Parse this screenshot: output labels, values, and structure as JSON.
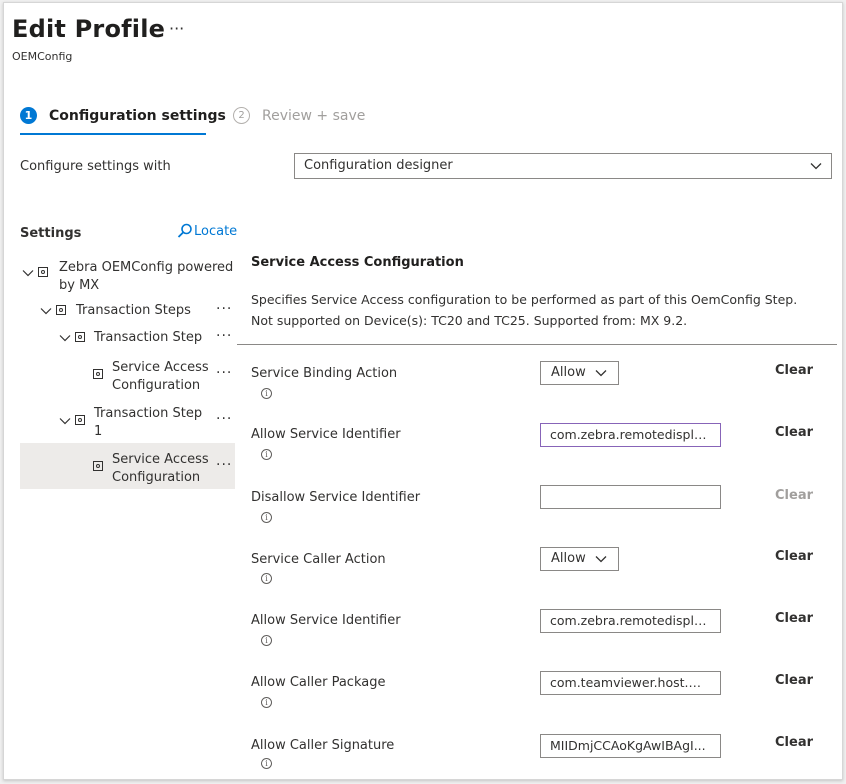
{
  "header": {
    "title": "Edit Profile",
    "more": "···",
    "subtitle": "OEMConfig"
  },
  "steps": [
    {
      "number": "1",
      "label": "Configuration settings",
      "active": true
    },
    {
      "number": "2",
      "label": "Review + save",
      "active": false
    }
  ],
  "configure": {
    "label": "Configure settings with",
    "selected": "Configuration designer"
  },
  "settings": {
    "label": "Settings",
    "locate": "Locate"
  },
  "tree": {
    "root": "Zebra OEMConfig powered",
    "root_line2": "by MX",
    "transaction_steps": "Transaction Steps",
    "step": "Transaction Step",
    "service_access_line1": "Service Access",
    "service_access_line2": "Configuration",
    "step1_line1": "Transaction Step",
    "step1_line2": "1",
    "selected_line1": "Service Access",
    "selected_line2": "Configuration",
    "dots": "···"
  },
  "detail": {
    "title": "Service Access Configuration",
    "desc_line1": "Specifies Service Access configuration to be performed as part of this OemConfig Step.",
    "desc_line2": "Not supported on Device(s): TC20 and TC25. Supported from: MX 9.2."
  },
  "fields": [
    {
      "label": "Service Binding Action",
      "type": "select",
      "value": "Allow",
      "clear": "Clear",
      "clear_enabled": true
    },
    {
      "label": "Allow Service Identifier",
      "type": "text",
      "value": "com.zebra.remotedispla...",
      "clear": "Clear",
      "clear_enabled": true
    },
    {
      "label": "Disallow Service Identifier",
      "type": "text",
      "value": "",
      "clear": "Clear",
      "clear_enabled": false
    },
    {
      "label": "Service Caller Action",
      "type": "select",
      "value": "Allow",
      "clear": "Clear",
      "clear_enabled": true
    },
    {
      "label": "Allow Service Identifier",
      "type": "text",
      "value": "com.zebra.remotedispla...",
      "clear": "Clear",
      "clear_enabled": true
    },
    {
      "label": "Allow Caller Package",
      "type": "text",
      "value": "com.teamviewer.host.m...",
      "clear": "Clear",
      "clear_enabled": true
    },
    {
      "label": "Allow Caller Signature",
      "type": "text",
      "value": "MIIDmjCCAoKgAwIBAgI...",
      "clear": "Clear",
      "clear_enabled": true
    }
  ],
  "info_glyph": "i",
  "colors": {
    "accent": "#0078d4",
    "focus": "#8764b8",
    "selected_bg": "#edebe9"
  }
}
